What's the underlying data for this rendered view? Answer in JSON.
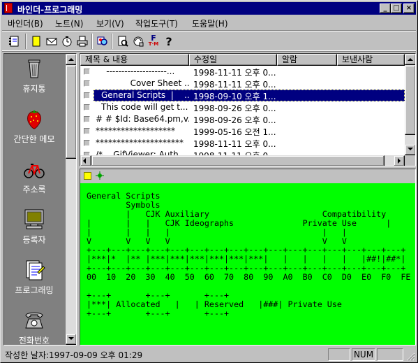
{
  "app": {
    "title": "바인더-프로그래밍"
  },
  "window_controls": {
    "minimize": "_",
    "maximize": "□",
    "close": "×"
  },
  "menu": [
    {
      "label": "바인더(B)"
    },
    {
      "label": "노트(N)"
    },
    {
      "label": "보기(V)"
    },
    {
      "label": "작업도구(T)"
    },
    {
      "label": "도움말(H)"
    }
  ],
  "toolbar": {
    "icons": [
      "binder-icon",
      "new-note-icon",
      "mail-icon",
      "timer-icon",
      "print-icon",
      "find-icon",
      "preview-icon",
      "encode-icon",
      "font-icon",
      "help-icon"
    ],
    "help_glyph": "?",
    "font_glyph": "F",
    "font_sub": "T·M"
  },
  "sidebar": {
    "items": [
      {
        "label": "휴지통",
        "icon": "trash-icon"
      },
      {
        "label": "간단한 메모",
        "icon": "strawberry-icon"
      },
      {
        "label": "주소록",
        "icon": "bicycle-icon"
      },
      {
        "label": "등록자",
        "icon": "monitor-icon"
      },
      {
        "label": "프로그래밍",
        "icon": "document-icon"
      },
      {
        "label": "전화번호",
        "icon": "telephone-icon"
      }
    ]
  },
  "list": {
    "columns": [
      "제목 & 내용",
      "수정일",
      "알람",
      "보낸사람"
    ],
    "rows": [
      {
        "title": "    --------------------...",
        "date": "1998-11-11 오후 0...",
        "selected": false
      },
      {
        "title": "             Cover Sheet ...",
        "date": "1998-11-11 오후 0...",
        "selected": false
      },
      {
        "title": "General Scripts  |    ...",
        "date": "1998-09-10 오후 1...",
        "selected": true
      },
      {
        "title": "This code will get t...",
        "date": "1998-09-26 오후 0...",
        "selected": false
      },
      {
        "title": "# # $Id: Base64.pm,v...",
        "date": "1998-09-26 오후 0...",
        "selected": false
      },
      {
        "title": "*******************",
        "date": "1999-05-16 오전 1...",
        "selected": false
      },
      {
        "title": "*********************",
        "date": "1998-11-11 오후 0...",
        "selected": false
      },
      {
        "title": "/*    GifViewer: Auth...",
        "date": "1998-11-11 오후 0...",
        "selected": false
      }
    ]
  },
  "preview": {
    "content": "General Scripts\n        Symbols\n        |   CJK Auxiliary                       Compatibility\n|       |   |   CJK Ideographs              Private Use      |\n|       |   |   |                               |   |\nV       V   V   V                               V   V\n+---+---+---+---+---+---+---+---+---+---+---+---+---+---+---+---+\n|***|*  |** |***|***|***|***|***|***|   |   |   |   |   |##!|##*|\n+---+---+---+---+---+---+---+---+---+---+---+---+---+---+---+---+\n00  10  20  30  40  50  60  70  80  90  A0  B0  C0  D0  E0  F0  FE\n\n+---+       +---+       +---+\n|***| Allocated   |   | Reserved   |###| Private Use\n+---+       +---+       +---+"
  },
  "status": {
    "text": "작성한 날자:1997-09-09 오후 01:29",
    "num": "NUM"
  },
  "colors": {
    "titlebar": "#000080",
    "selection": "#000080",
    "preview_background": "#00ff00",
    "sidebar": "#808080",
    "chrome": "#c0c0c0"
  }
}
